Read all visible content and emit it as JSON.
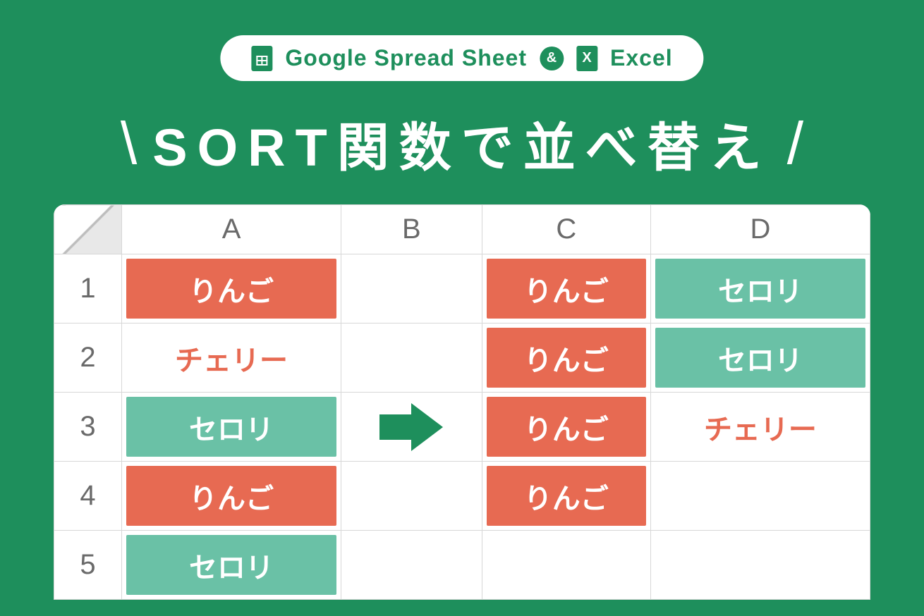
{
  "badge": {
    "google": "Google Spread Sheet",
    "amp": "&",
    "excel": "Excel"
  },
  "title": {
    "slash": "/",
    "text": "SORT関数で並べ替え"
  },
  "sheet": {
    "columns": [
      "A",
      "B",
      "C",
      "D"
    ],
    "rows": [
      "1",
      "2",
      "3",
      "4",
      "5"
    ],
    "cells": {
      "A1": "りんご",
      "A2": "チェリー",
      "A3": "セロリ",
      "A4": "りんご",
      "A5": "セロリ",
      "C1": "りんご",
      "C2": "りんご",
      "C3": "りんご",
      "C4": "りんご",
      "D1": "セロリ",
      "D2": "セロリ",
      "D3": "チェリー"
    }
  },
  "colors": {
    "accent": "#1e8f5c",
    "red": "#e76a52",
    "teal": "#6ac1a6"
  }
}
